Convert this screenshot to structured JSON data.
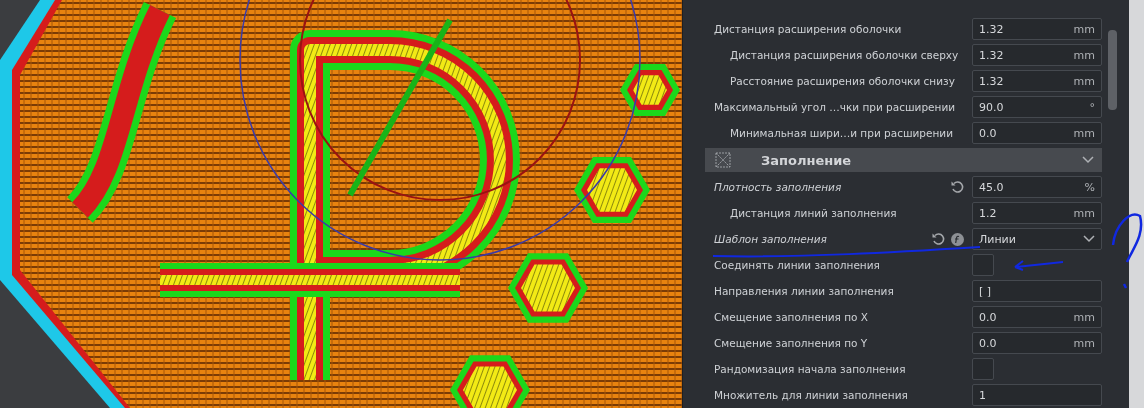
{
  "settings": [
    {
      "kind": "number",
      "label": "Дистанция расширения оболочки",
      "value": "1.32",
      "unit": "mm",
      "children": [
        {
          "kind": "number",
          "label": "Дистанция расширения оболочки сверху",
          "value": "1.32",
          "unit": "mm"
        },
        {
          "kind": "number",
          "label": "Расстояние расширения оболочки снизу",
          "value": "1.32",
          "unit": "mm"
        }
      ]
    },
    {
      "kind": "number",
      "label": "Максимальный угол …чки при расширении",
      "value": "90.0",
      "unit": "°",
      "children": [
        {
          "kind": "number",
          "label": "Минимальная шири…и при расширении",
          "value": "0.0",
          "unit": "mm"
        }
      ]
    },
    {
      "kind": "section",
      "label": "Заполнение",
      "expanded": true
    },
    {
      "kind": "number",
      "label": "Плотность заполнения",
      "value": "45.0",
      "unit": "%",
      "modified": true,
      "children": [
        {
          "kind": "number",
          "label": "Дистанция линий заполнения",
          "value": "1.2",
          "unit": "mm"
        }
      ]
    },
    {
      "kind": "dropdown",
      "label": "Шаблон заполнения",
      "value": "Линии",
      "modified": true,
      "function": true
    },
    {
      "kind": "checkbox",
      "label": "Соединять линии заполнения",
      "checked": false
    },
    {
      "kind": "text",
      "label": "Направления линии заполнения",
      "value": "[ ]"
    },
    {
      "kind": "number",
      "label": "Смещение заполнения по X",
      "value": "0.0",
      "unit": "mm"
    },
    {
      "kind": "number",
      "label": "Смещение заполнения по Y",
      "value": "0.0",
      "unit": "mm"
    },
    {
      "kind": "checkbox",
      "label": "Рандомизация начала заполнения",
      "checked": false
    },
    {
      "kind": "text",
      "label": "Множитель для линии заполнения",
      "value": "1"
    }
  ]
}
